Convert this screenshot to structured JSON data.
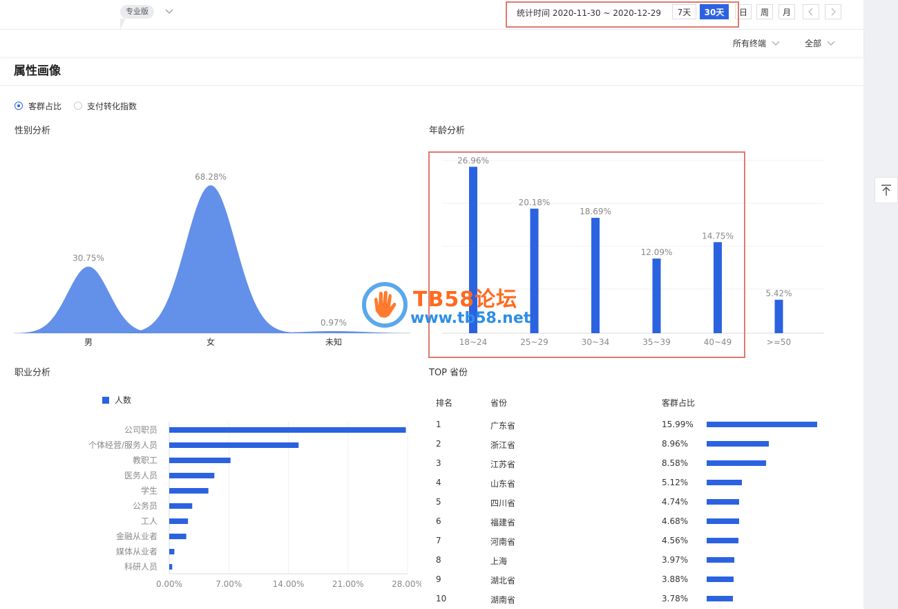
{
  "header": {
    "edition_label": "专业版",
    "date_range": "统计时间 2020-11-30 ~ 2020-12-29",
    "buttons": [
      {
        "label": "7天",
        "active": false
      },
      {
        "label": "30天",
        "active": true
      },
      {
        "label": "日",
        "active": false
      },
      {
        "label": "周",
        "active": false
      },
      {
        "label": "月",
        "active": false
      }
    ],
    "prev_icon": "chevron-left-icon",
    "next_icon": "chevron-right-icon"
  },
  "filters": {
    "terminal": "所有终端",
    "scope": "全部"
  },
  "section": {
    "title": "属性画像",
    "radios": [
      {
        "label": "客群占比",
        "checked": true
      },
      {
        "label": "支付转化指数",
        "checked": false
      }
    ]
  },
  "accent_color": "#2b62e0",
  "chart_data": [
    {
      "type": "area",
      "title": "性别分析",
      "categories": [
        "男",
        "女",
        "未知"
      ],
      "values": [
        30.75,
        68.28,
        0.97
      ],
      "value_labels": [
        "30.75%",
        "68.28%",
        "0.97%"
      ],
      "color": "#5b8ae8"
    },
    {
      "type": "bar",
      "title": "年龄分析",
      "categories": [
        "18~24",
        "25~29",
        "30~34",
        "35~39",
        "40~49",
        ">=50"
      ],
      "values": [
        26.96,
        20.18,
        18.69,
        12.09,
        14.75,
        5.42
      ],
      "value_labels": [
        "26.96%",
        "20.18%",
        "18.69%",
        "12.09%",
        "14.75%",
        "5.42%"
      ],
      "ylim": [
        0,
        28
      ],
      "grid": true,
      "color": "#2b62e0"
    },
    {
      "type": "bar",
      "orientation": "horizontal",
      "title": "职业分析",
      "legend": "人数",
      "categories": [
        "公司职员",
        "个体经营/服务人员",
        "教职工",
        "医务人员",
        "学生",
        "公务员",
        "工人",
        "金融从业者",
        "媒体从业者",
        "科研人员"
      ],
      "values": [
        27.8,
        15.2,
        7.2,
        5.3,
        4.6,
        2.7,
        2.2,
        2.0,
        0.6,
        0.35
      ],
      "xticks": [
        "0.00%",
        "7.00%",
        "14.00%",
        "21.00%",
        "28.00%"
      ],
      "xlim": [
        0,
        28
      ],
      "color": "#2b62e0"
    },
    {
      "type": "table",
      "title": "TOP 省份",
      "columns": [
        "排名",
        "省份",
        "客群占比"
      ],
      "rows": [
        {
          "rank": "1",
          "province": "广东省",
          "share": "15.99%",
          "value": 15.99
        },
        {
          "rank": "2",
          "province": "浙江省",
          "share": "8.96%",
          "value": 8.96
        },
        {
          "rank": "3",
          "province": "江苏省",
          "share": "8.58%",
          "value": 8.58
        },
        {
          "rank": "4",
          "province": "山东省",
          "share": "5.12%",
          "value": 5.12
        },
        {
          "rank": "5",
          "province": "四川省",
          "share": "4.74%",
          "value": 4.74
        },
        {
          "rank": "6",
          "province": "福建省",
          "share": "4.68%",
          "value": 4.68
        },
        {
          "rank": "7",
          "province": "河南省",
          "share": "4.56%",
          "value": 4.56
        },
        {
          "rank": "8",
          "province": "上海",
          "share": "3.97%",
          "value": 3.97
        },
        {
          "rank": "9",
          "province": "湖北省",
          "share": "3.88%",
          "value": 3.88
        },
        {
          "rank": "10",
          "province": "湖南省",
          "share": "3.78%",
          "value": 3.78
        }
      ]
    }
  ],
  "watermark": {
    "title": "TB58论坛",
    "url": "www.tb58.net",
    "icon": "hand-logo-icon"
  },
  "back_to_top_icon": "arrow-up-to-top-icon"
}
